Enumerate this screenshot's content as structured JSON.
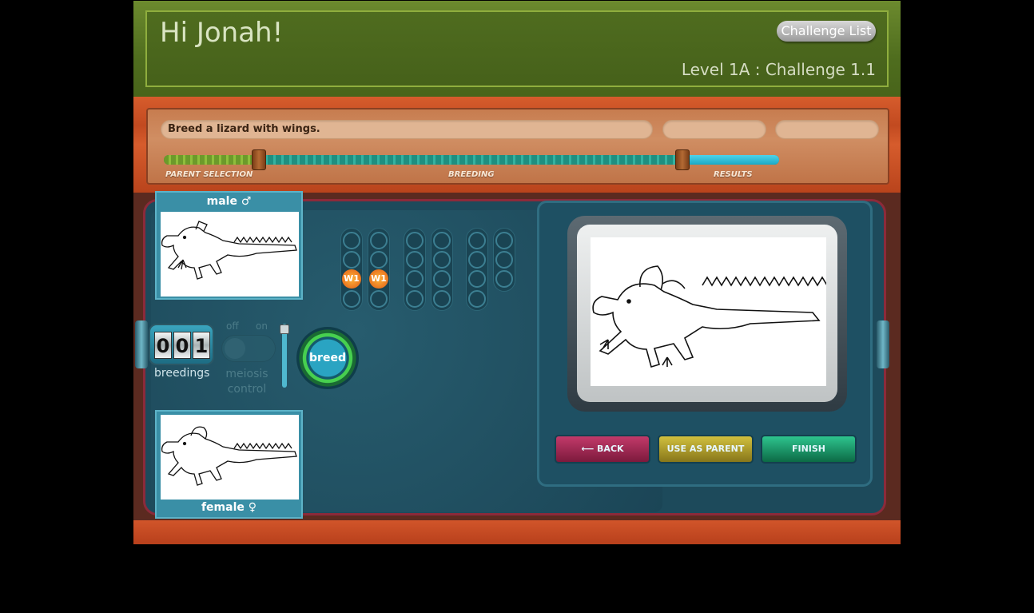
{
  "header": {
    "greeting": "Hi Jonah!",
    "challenge_list_label": "Challenge List",
    "level_label": "Level 1A : Challenge 1.1"
  },
  "task": {
    "text": "Breed a lizard with wings."
  },
  "progress": {
    "stages": [
      "PARENT SELECTION",
      "BREEDING",
      "RESULTS"
    ],
    "current_stage": "RESULTS"
  },
  "parents": {
    "male_label": "male ♂",
    "female_label": "female ♀"
  },
  "counter": {
    "digits": [
      "0",
      "0",
      "1"
    ],
    "label": "breedings"
  },
  "meiosis": {
    "off_label": "off",
    "on_label": "on",
    "label_line1": "meiosis",
    "label_line2": "control"
  },
  "breed_button": {
    "label": "breed"
  },
  "alleles": {
    "col1": "W1",
    "col2": "W1"
  },
  "actions": {
    "back": "BACK",
    "use_as_parent": "USE AS PARENT",
    "finish": "FINISH"
  },
  "colors": {
    "header_green": "#4f6d1e",
    "wood_orange": "#c24a20",
    "console_teal": "#1d4a5b",
    "allele_orange": "#e05a14"
  }
}
